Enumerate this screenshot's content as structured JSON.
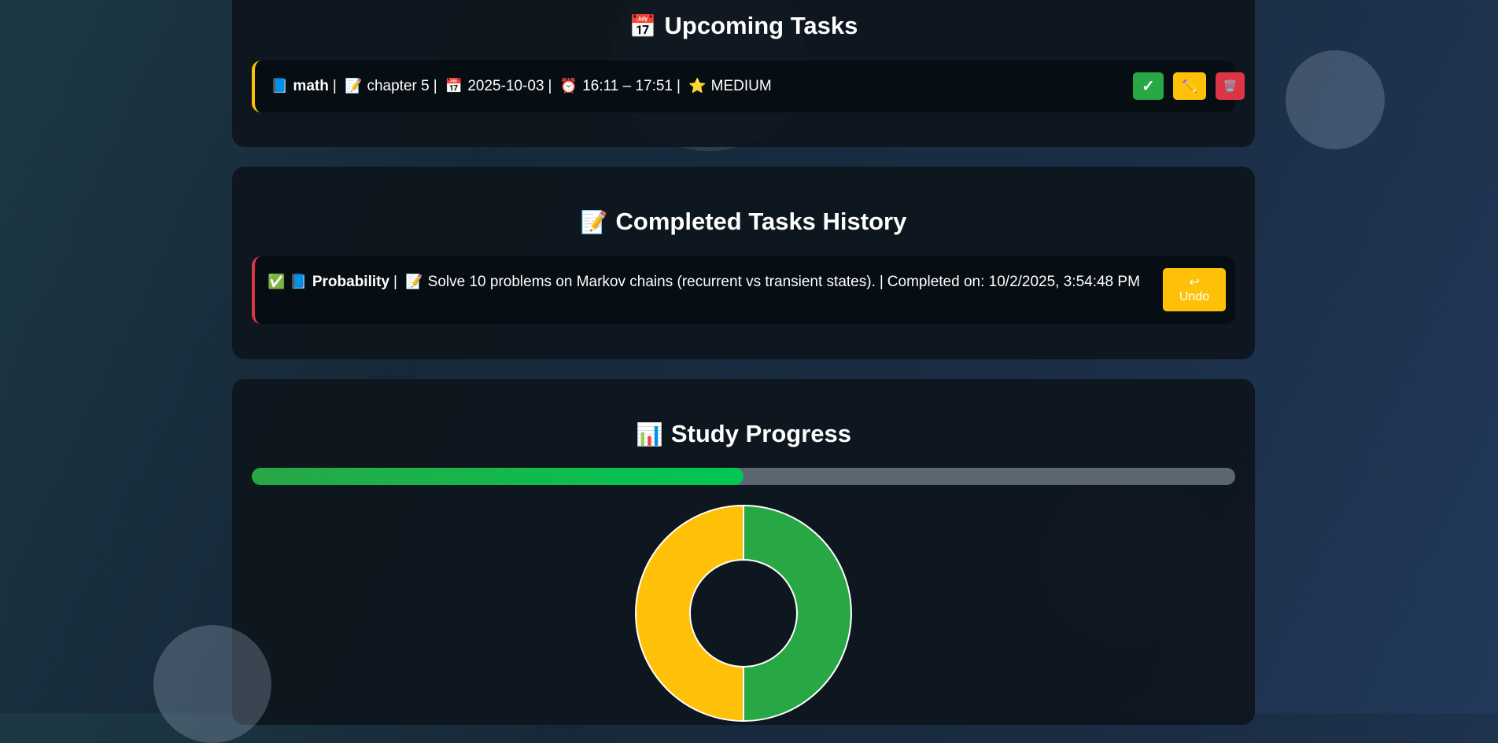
{
  "upcoming": {
    "title": "Upcoming Tasks",
    "title_icon": "📅",
    "tasks": [
      {
        "subject_icon": "📘",
        "subject": "math",
        "topic_icon": "📝",
        "topic": "chapter 5",
        "date_icon": "📅",
        "date": "2025-10-03",
        "time_icon": "⏰",
        "time": "16:11 – 17:51",
        "priority_icon": "⭐",
        "priority": "MEDIUM",
        "actions": {
          "complete": "✓",
          "edit": "✏️",
          "delete": "🗑️"
        }
      }
    ]
  },
  "history": {
    "title": "Completed Tasks History",
    "title_icon": "📝",
    "tasks": [
      {
        "check_icon": "✅",
        "subject_icon": "📘",
        "subject": "Probability",
        "topic_icon": "📝",
        "topic": "Solve 10 problems on Markov chains (recurrent vs transient states).",
        "completed_label": "Completed on: 10/2/2025, 3:54:48 PM",
        "undo_icon": "↩",
        "undo_label": "Undo"
      }
    ]
  },
  "progress": {
    "title": "Study Progress",
    "title_icon": "📊",
    "percent": 50,
    "chart_data": {
      "type": "pie",
      "categories": [
        "",
        ""
      ],
      "values": [
        1,
        1
      ],
      "colors": [
        "#28a745",
        "#ffc107"
      ]
    }
  },
  "colors": {
    "complete": "#28a745",
    "edit": "#ffc107",
    "delete": "#dc3545",
    "upcoming_accent": "#ffc107",
    "history_accent": "#dc3545"
  }
}
